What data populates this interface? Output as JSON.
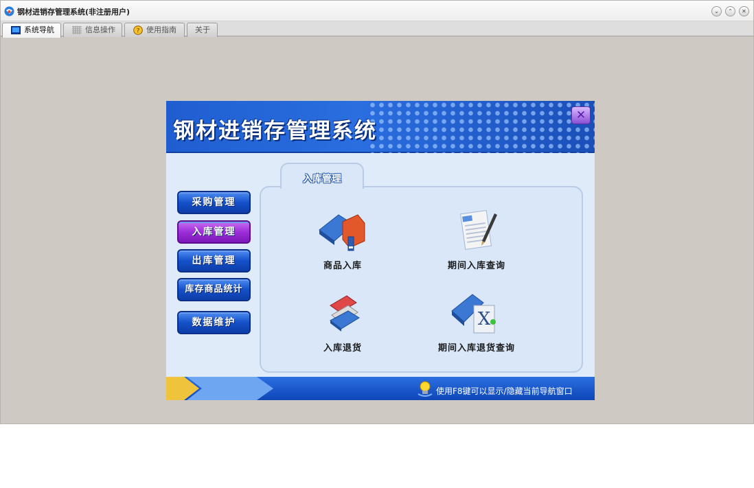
{
  "window": {
    "title": "钢材进销存管理系统(非注册用户)",
    "buttons": {
      "minimize": "⌄",
      "maximize": "⌃",
      "close": "✕"
    }
  },
  "tabs": [
    {
      "label": "系统导航",
      "icon": "monitor-icon",
      "active": true
    },
    {
      "label": "信息操作",
      "icon": "grid-icon",
      "active": false
    },
    {
      "label": "使用指南",
      "icon": "help-icon",
      "active": false
    },
    {
      "label": "关于",
      "icon": "",
      "active": false
    }
  ],
  "panel": {
    "banner_title": "钢材进销存管理系统",
    "close_icon": "✕",
    "section_title": "入库管理",
    "side_buttons": [
      {
        "label": "采购管理",
        "active": false
      },
      {
        "label": "入库管理",
        "active": true
      },
      {
        "label": "出库管理",
        "active": false
      },
      {
        "label": "库存商品统计",
        "active": false
      },
      {
        "label": "数据维护",
        "active": false
      }
    ],
    "functions": [
      {
        "label": "商品入库",
        "icon": "book-stock-in-icon"
      },
      {
        "label": "期间入库查询",
        "icon": "document-pen-icon"
      },
      {
        "label": "入库退货",
        "icon": "books-return-icon"
      },
      {
        "label": "期间入库退货查询",
        "icon": "mac-osx-book-icon"
      }
    ],
    "tip_text": "使用F8键可以显示/隐藏当前导航窗口"
  },
  "colors": {
    "window_bg": "#cfc9c4",
    "banner_blue": "#1f5ed0",
    "side_button_blue": "#1550c9",
    "side_button_active": "#9b2fd9",
    "panel_bg": "#e0ebfa"
  }
}
